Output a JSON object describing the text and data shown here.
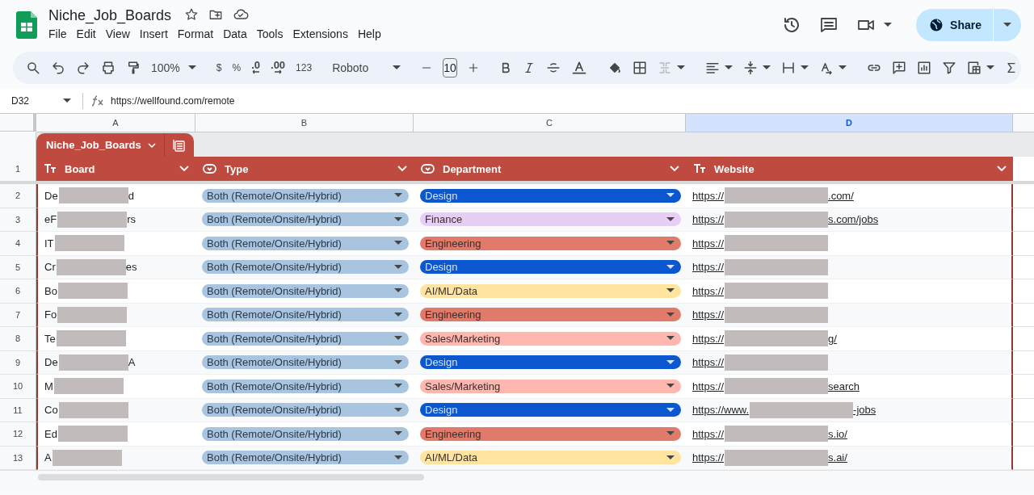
{
  "document": {
    "title": "Niche_Job_Boards"
  },
  "menu": [
    "File",
    "Edit",
    "View",
    "Insert",
    "Format",
    "Data",
    "Tools",
    "Extensions",
    "Help"
  ],
  "share_button": {
    "label": "Share"
  },
  "toolbar": {
    "zoom": "100%",
    "currency": "$",
    "percent": "%",
    "decrease_decimals": ".0",
    "increase_decimals": ".00",
    "more_formats": "123",
    "font": "Roboto",
    "font_size": "10"
  },
  "formula_bar": {
    "cell": "D32",
    "formula": "https://wellfound.com/remote"
  },
  "columns": [
    {
      "letter": "A",
      "selected": false
    },
    {
      "letter": "B",
      "selected": false
    },
    {
      "letter": "C",
      "selected": false
    },
    {
      "letter": "D",
      "selected": true
    }
  ],
  "table": {
    "name": "Niche_Job_Boards",
    "headers": [
      {
        "row": "1",
        "label": "Board",
        "kind": "text"
      },
      {
        "label": "Type",
        "kind": "dropdown"
      },
      {
        "label": "Department",
        "kind": "dropdown"
      },
      {
        "label": "Website",
        "kind": "text"
      }
    ],
    "rows": [
      {
        "row": "2",
        "board": {
          "start": "De",
          "end": "d"
        },
        "type": "Both (Remote/Onsite/Hybrid)",
        "department": {
          "label": "Design",
          "color": "#0b57d0"
        },
        "website": {
          "start": "https://",
          "end": ".com/"
        }
      },
      {
        "row": "3",
        "board": {
          "start": "eF",
          "end": "rs"
        },
        "type": "Both (Remote/Onsite/Hybrid)",
        "department": {
          "label": "Finance",
          "color": "#e7cef4"
        },
        "website": {
          "start": "https://",
          "end": "s.com/jobs"
        }
      },
      {
        "row": "4",
        "board": {
          "start": "IT"
        },
        "type": "Both (Remote/Onsite/Hybrid)",
        "department": {
          "label": "Engineering",
          "color": "#e07b6c"
        },
        "website": {
          "start": "https://"
        }
      },
      {
        "row": "5",
        "board": {
          "start": "Cr",
          "end": "es"
        },
        "type": "Both (Remote/Onsite/Hybrid)",
        "department": {
          "label": "Design",
          "color": "#0b57d0"
        },
        "website": {
          "start": "https://"
        }
      },
      {
        "row": "6",
        "board": {
          "start": "Bo"
        },
        "type": "Both (Remote/Onsite/Hybrid)",
        "department": {
          "label": "AI/ML/Data",
          "color": "#ffe5a0"
        },
        "website": {
          "start": "https://"
        }
      },
      {
        "row": "7",
        "board": {
          "start": "Fo"
        },
        "type": "Both (Remote/Onsite/Hybrid)",
        "department": {
          "label": "Engineering",
          "color": "#e07b6c"
        },
        "website": {
          "start": "https://"
        }
      },
      {
        "row": "8",
        "board": {
          "start": "Te"
        },
        "type": "Both (Remote/Onsite/Hybrid)",
        "department": {
          "label": "Sales/Marketing",
          "color": "#ffb7b0"
        },
        "website": {
          "start": "https://",
          "end": "g/"
        }
      },
      {
        "row": "9",
        "board": {
          "start": "De",
          "end": "A"
        },
        "type": "Both (Remote/Onsite/Hybrid)",
        "department": {
          "label": "Design",
          "color": "#0b57d0"
        },
        "website": {
          "start": "https://"
        }
      },
      {
        "row": "10",
        "board": {
          "start": "M"
        },
        "type": "Both (Remote/Onsite/Hybrid)",
        "department": {
          "label": "Sales/Marketing",
          "color": "#ffb7b0"
        },
        "website": {
          "start": "https://",
          "end": "search"
        }
      },
      {
        "row": "11",
        "board": {
          "start": "Co"
        },
        "type": "Both (Remote/Onsite/Hybrid)",
        "department": {
          "label": "Design",
          "color": "#0b57d0"
        },
        "website": {
          "start": "https://www.",
          "end": "-jobs"
        }
      },
      {
        "row": "12",
        "board": {
          "start": "Ed"
        },
        "type": "Both (Remote/Onsite/Hybrid)",
        "department": {
          "label": "Engineering",
          "color": "#e07b6c"
        },
        "website": {
          "start": "https://",
          "end": "s.io/"
        }
      },
      {
        "row": "13",
        "board": {
          "start": "A"
        },
        "type": "Both (Remote/Onsite/Hybrid)",
        "department": {
          "label": "AI/ML/Data",
          "color": "#ffe5a0"
        },
        "website": {
          "start": "https://",
          "end": "s.ai/"
        }
      }
    ]
  }
}
